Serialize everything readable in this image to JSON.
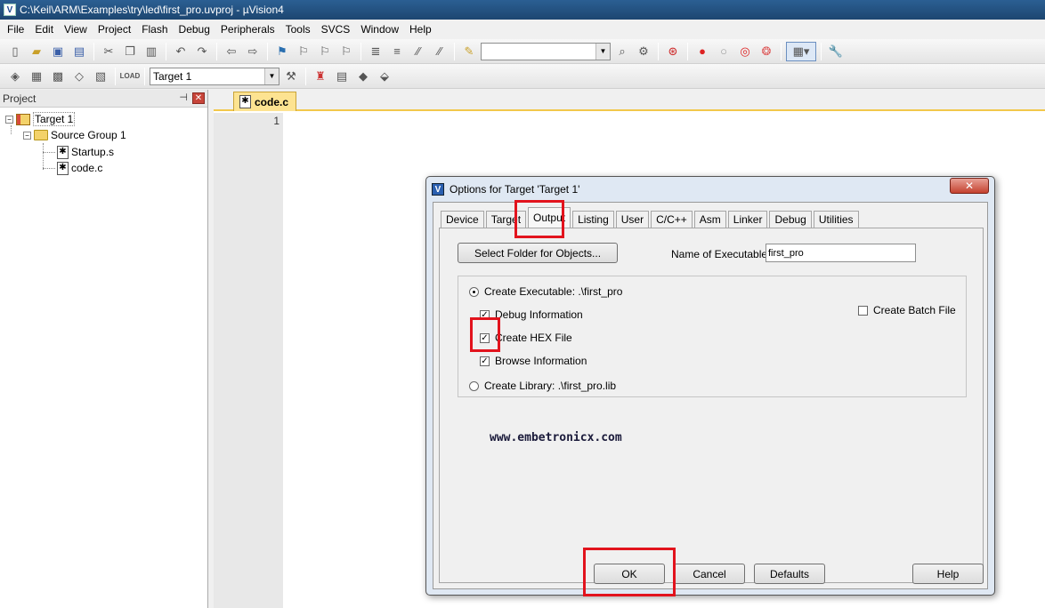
{
  "window": {
    "title": "C:\\Keil\\ARM\\Examples\\try\\led\\first_pro.uvproj - µVision4"
  },
  "menu": [
    "File",
    "Edit",
    "View",
    "Project",
    "Flash",
    "Debug",
    "Peripherals",
    "Tools",
    "SVCS",
    "Window",
    "Help"
  ],
  "toolbar": {
    "target_select": "Target 1"
  },
  "project": {
    "header": "Project",
    "target": "Target 1",
    "group": "Source Group 1",
    "files": [
      "Startup.s",
      "code.c"
    ]
  },
  "editor": {
    "tab": "code.c",
    "line_number": "1"
  },
  "dialog": {
    "title": "Options for Target 'Target 1'",
    "tabs": [
      "Device",
      "Target",
      "Output",
      "Listing",
      "User",
      "C/C++",
      "Asm",
      "Linker",
      "Debug",
      "Utilities"
    ],
    "active_tab": "Output",
    "select_folder_button": "Select Folder for Objects...",
    "name_exe_label": "Name of Executable:",
    "name_exe_value": "first_pro",
    "create_exe_label": "Create Executable:  .\\first_pro",
    "debug_info": "Debug Information",
    "create_hex": "Create HEX File",
    "browse_info": "Browse Information",
    "create_batch": "Create Batch File",
    "create_lib": "Create Library:  .\\first_pro.lib",
    "watermark": "www.embetronicx.com",
    "ok": "OK",
    "cancel": "Cancel",
    "defaults": "Defaults",
    "help": "Help"
  },
  "colors": {
    "highlight": "#e2131d",
    "title_bar": "#2b5f93",
    "editor_tab": "#fde391"
  },
  "icons": [
    "new-file-icon",
    "open-icon",
    "save-icon",
    "save-all-icon",
    "cut-icon",
    "copy-icon",
    "paste-icon",
    "undo-icon",
    "redo-icon",
    "bookmark-icon",
    "indent-icon",
    "find-icon",
    "debug-icon",
    "run-icon",
    "build-icon",
    "settings-icon"
  ]
}
